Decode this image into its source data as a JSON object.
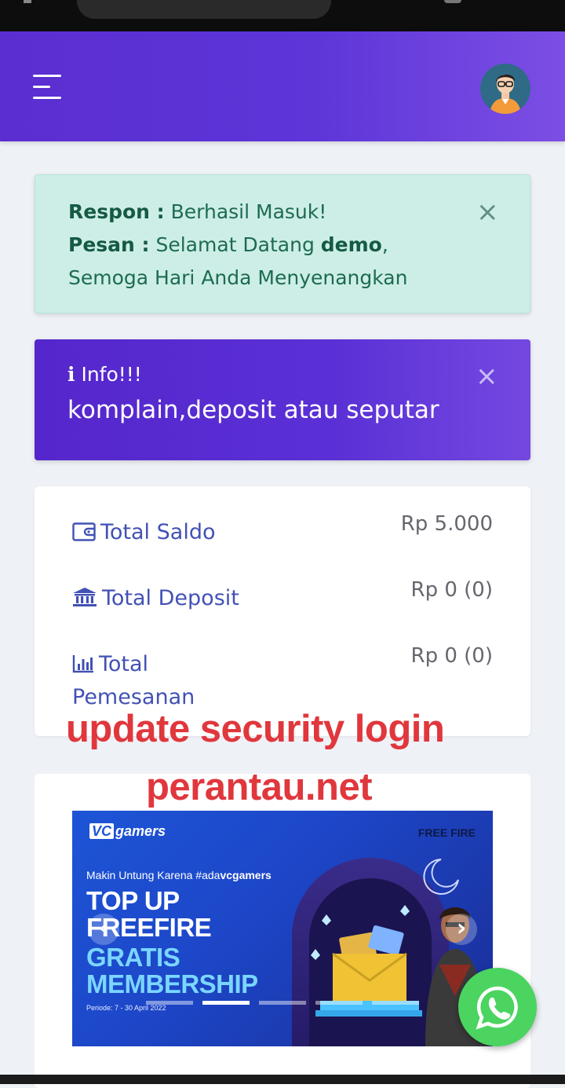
{
  "alert_success": {
    "respon_label": "Respon :",
    "respon_text": " Berhasil Masuk!",
    "pesan_label": "Pesan :",
    "pesan_text": " Selamat Datang ",
    "username": "demo",
    "pesan_suffix": ",",
    "line3": "Semoga Hari Anda Menyenangkan",
    "close": "×"
  },
  "alert_info": {
    "icon": "i",
    "title": " Info!!!",
    "body": "komplain,deposit atau seputar",
    "close": "×"
  },
  "stats": {
    "saldo_label": "Total Saldo",
    "saldo_value": "Rp 5.000",
    "deposit_label": "Total Deposit",
    "deposit_value": "Rp 0 (0)",
    "pemesanan_label_1": "Total",
    "pemesanan_label_2": "Pemesanan",
    "pemesanan_value": "Rp 0 (0)"
  },
  "watermark": {
    "line1": "update security login",
    "line2": "perantau.net"
  },
  "banner": {
    "brand_box": "VC",
    "brand_text": "gamers",
    "game": "FREE FIRE",
    "tagline_prefix": "Makin Untung Karena #ada",
    "tagline_bold": "vcgamers",
    "line1": "TOP UP",
    "line2": "FREEFIRE",
    "line3": "GRATIS",
    "line4": "MEMBERSHIP",
    "period": "Periode: 7 - 30 April 2022",
    "active_slide": 2
  },
  "colors": {
    "header": "#5b2ed1",
    "success_bg": "#cdeee6",
    "info_bg": "#5526cc",
    "stat_label": "#4251b5",
    "watermark": "#e0373d",
    "whatsapp": "#4bd460"
  },
  "icons": {
    "menu": "hamburger-menu-icon",
    "avatar": "user-avatar",
    "saldo": "wallet-icon",
    "deposit": "bank-icon",
    "pemesanan": "bar-chart-icon",
    "whatsapp": "whatsapp-icon"
  }
}
